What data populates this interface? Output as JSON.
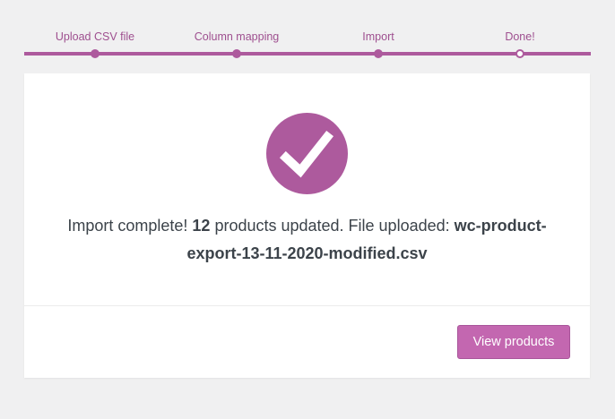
{
  "steps": [
    {
      "label": "Upload CSV file",
      "state": "done"
    },
    {
      "label": "Column mapping",
      "state": "done"
    },
    {
      "label": "Import",
      "state": "done"
    },
    {
      "label": "Done!",
      "state": "active"
    }
  ],
  "result": {
    "icon": "checkmark-icon",
    "text_before_count": "Import complete! ",
    "count": "12",
    "text_after_count": " products updated. File uploaded: ",
    "filename": "wc-product-export-13-11-2020-modified.csv"
  },
  "actions": {
    "view_products_label": "View products"
  },
  "colors": {
    "accent": "#ad5a9d",
    "button": "#c367b0",
    "background": "#f0f0f1"
  }
}
